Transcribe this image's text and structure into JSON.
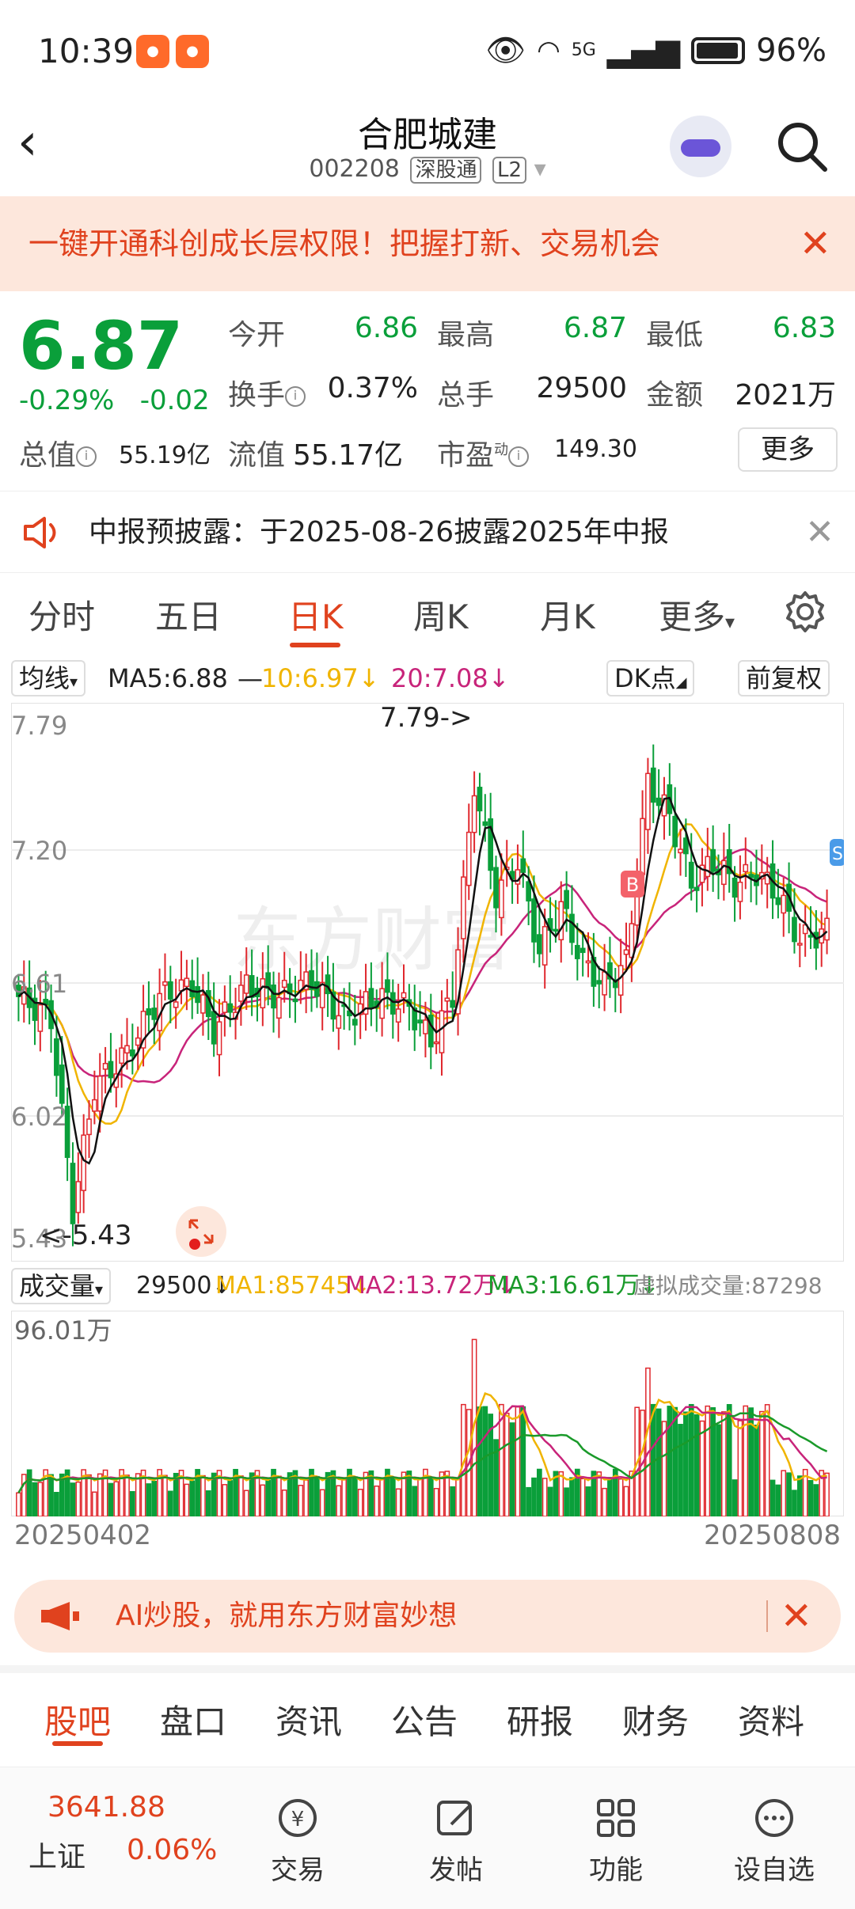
{
  "status_bar": {
    "time": "10:39",
    "battery": "96%",
    "signal_label": "5G"
  },
  "header": {
    "title": "合肥城建",
    "code": "002208",
    "tag1": "深股通",
    "tag2": "L2",
    "logo_text": "东方财富"
  },
  "promo_banner": {
    "text": "一键开通科创成长层权限！把握打新、交易机会"
  },
  "quote": {
    "price": "6.87",
    "change_pct": "-0.29%",
    "change": "-0.02",
    "open_label": "今开",
    "open": "6.86",
    "high_label": "最高",
    "high": "6.87",
    "low_label": "最低",
    "low": "6.83",
    "turnover_label": "换手",
    "turnover": "0.37%",
    "volume_label": "总手",
    "volume": "29500",
    "amount_label": "金额",
    "amount": "2021万",
    "mktcap_label": "总值",
    "mktcap": "55.19亿",
    "float_label": "流值",
    "float_cap": "55.17亿",
    "pe_label": "市盈",
    "pe_sup": "动",
    "pe": "149.30",
    "more_label": "更多"
  },
  "notice": {
    "text": "中报预披露：于2025-08-26披露2025年中报"
  },
  "chart_tabs": [
    {
      "label": "分时"
    },
    {
      "label": "五日"
    },
    {
      "label": "日K"
    },
    {
      "label": "周K"
    },
    {
      "label": "月K"
    },
    {
      "label": "更多"
    }
  ],
  "ma_legend": {
    "selector": "均线",
    "ma5": "MA5:6.88",
    "ma10": "10:6.97",
    "ma20": "20:7.08",
    "dk": "DK点",
    "adjust": "前复权"
  },
  "volume_legend": {
    "selector": "成交量",
    "vol": "29500",
    "ma1": "MA1:85745",
    "ma2": "MA2:13.72万",
    "ma3": "MA3:16.61万",
    "virtual": "虚拟成交量:87298"
  },
  "chart_data": {
    "type": "candlestick",
    "y_ticks": [
      "7.79",
      "7.20",
      "6.61",
      "6.02",
      "5.43"
    ],
    "ylim": [
      5.43,
      7.79
    ],
    "max_annotation": "7.79->",
    "min_annotation": "<-5.43",
    "volume_max_label": "96.01万",
    "start_date": "20250402",
    "end_date": "20250808",
    "markers": [
      "B",
      "S"
    ],
    "colors": {
      "up": "#e0282e",
      "down": "#0a9f3a",
      "ma5": "#111111",
      "ma10": "#f0b400",
      "ma20": "#c8247a",
      "vol_ma3": "#1a9a2a"
    }
  },
  "ai_banner": {
    "text": "AI炒股，就用东方财富妙想"
  },
  "sub_tabs": [
    {
      "label": "股吧"
    },
    {
      "label": "盘口"
    },
    {
      "label": "资讯"
    },
    {
      "label": "公告"
    },
    {
      "label": "研报"
    },
    {
      "label": "财务"
    },
    {
      "label": "资料"
    }
  ],
  "bottom_bar": {
    "index_value": "3641.88",
    "index_name": "上证",
    "index_pct": "0.06%",
    "items": [
      {
        "label": "交易"
      },
      {
        "label": "发帖"
      },
      {
        "label": "功能"
      },
      {
        "label": "设自选"
      }
    ]
  }
}
